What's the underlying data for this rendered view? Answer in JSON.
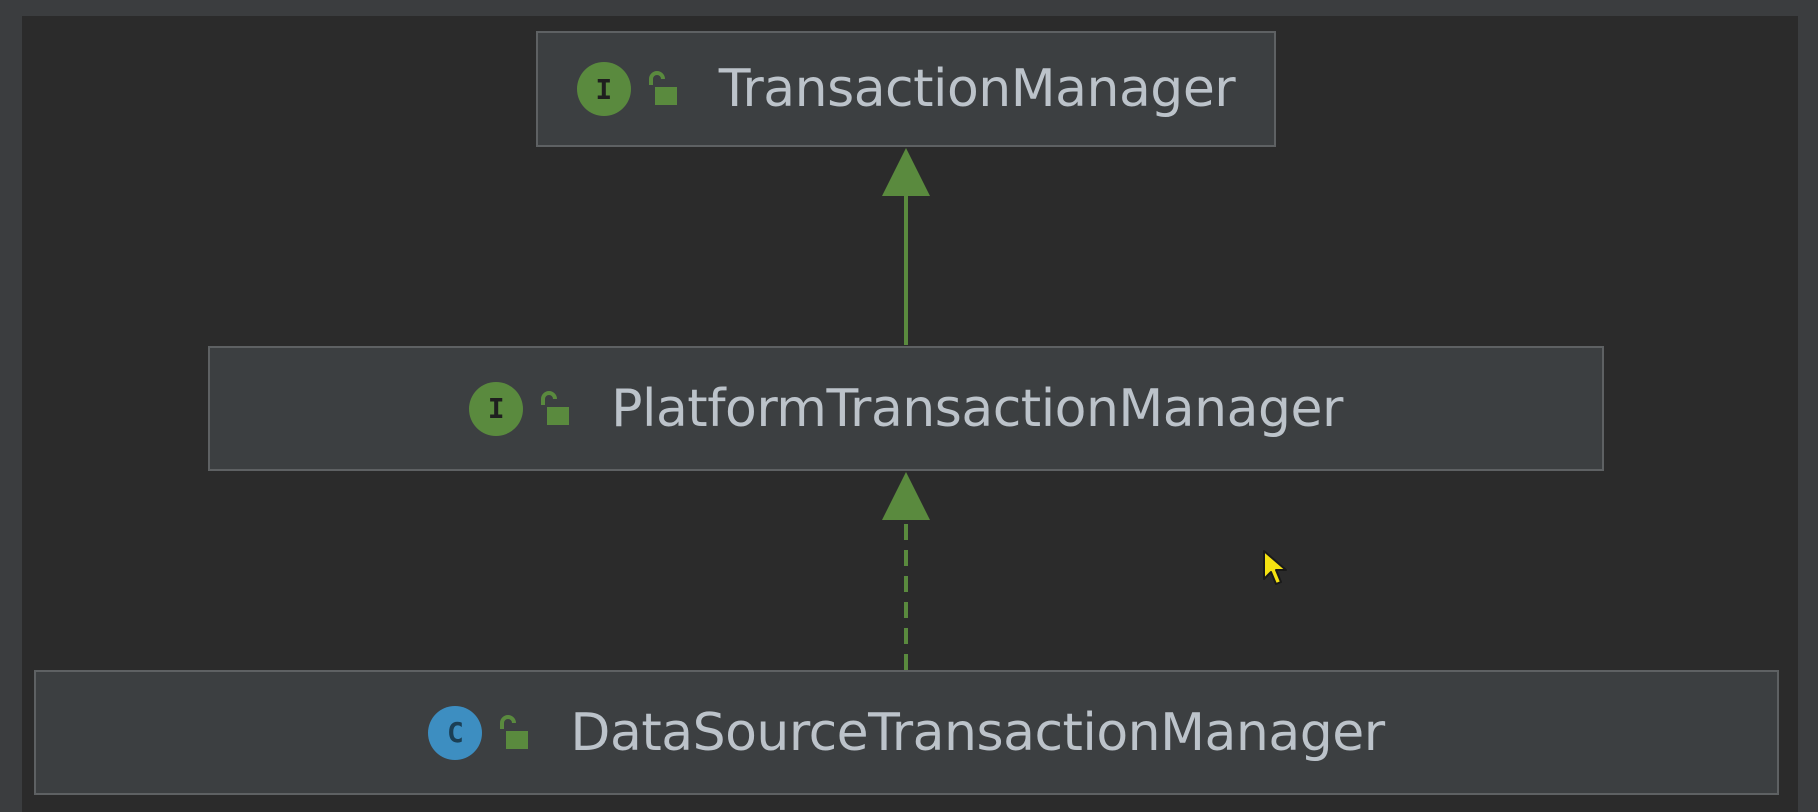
{
  "diagram": {
    "nodes": [
      {
        "id": "transaction-manager",
        "kind": "interface",
        "kind_letter": "I",
        "name": "TransactionManager"
      },
      {
        "id": "platform-transaction-manager",
        "kind": "interface",
        "kind_letter": "I",
        "name": "PlatformTransactionManager"
      },
      {
        "id": "datasource-transaction-manager",
        "kind": "class",
        "kind_letter": "C",
        "name": "DataSourceTransactionManager"
      }
    ],
    "edges": [
      {
        "from": "PlatformTransactionManager",
        "to": "TransactionManager",
        "relation": "extends",
        "style": "solid"
      },
      {
        "from": "DataSourceTransactionManager",
        "to": "PlatformTransactionManager",
        "relation": "implements",
        "style": "dashed"
      }
    ],
    "colors": {
      "background": "#2b2b2b",
      "node_fill": "#3c3f41",
      "node_border": "#5e6163",
      "arrow": "#5a8a3e",
      "interface_icon": "#5a8a3e",
      "class_icon": "#3d8ec1",
      "text": "#bcc3ca"
    }
  }
}
